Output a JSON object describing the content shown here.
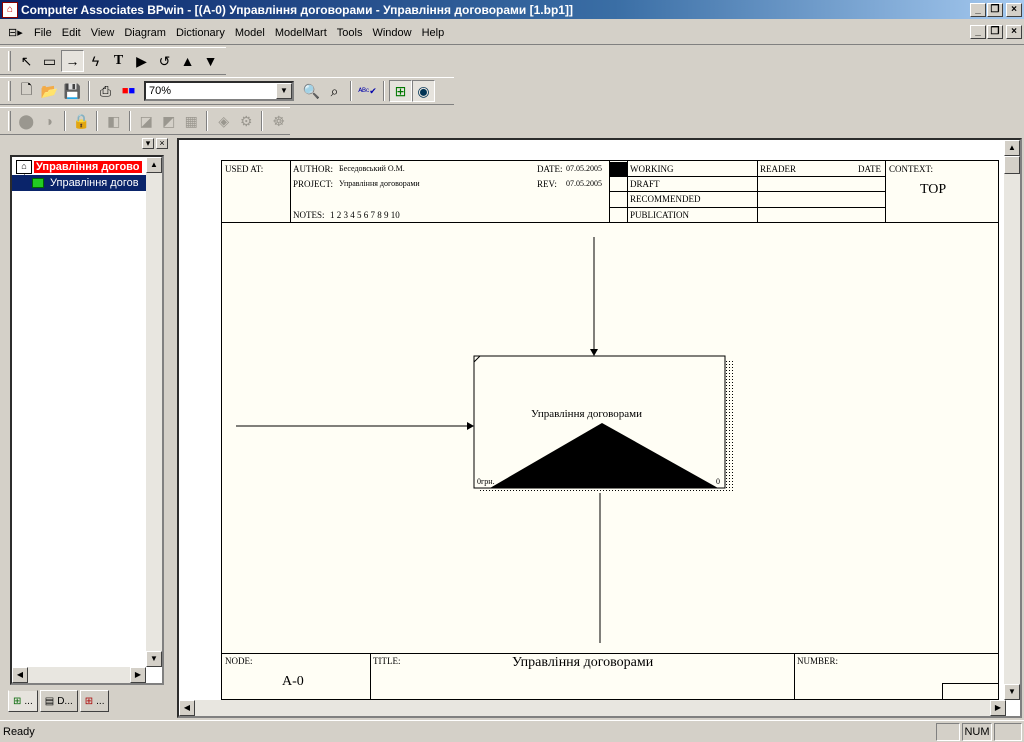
{
  "window": {
    "title": "Computer Associates BPwin - [(A-0) Управління договорами - Управління договорами  [1.bp1]]"
  },
  "menu": {
    "items": [
      "File",
      "Edit",
      "View",
      "Diagram",
      "Dictionary",
      "Model",
      "ModelMart",
      "Tools",
      "Window",
      "Help"
    ]
  },
  "toolbar": {
    "zoom": "70%"
  },
  "tree": {
    "root_label": "Управління догово",
    "child_label": "Управління догов"
  },
  "tabs": [
    "...",
    "D...",
    "..."
  ],
  "diagram": {
    "used_at_label": "USED AT:",
    "author_label": "AUTHOR:",
    "author": "Беседовський О.М.",
    "project_label": "PROJECT:",
    "project": "Управління договорами",
    "date_label": "DATE:",
    "date": "07.05.2005",
    "rev_label": "REV:",
    "rev": "07.05.2005",
    "notes_label": "NOTES:",
    "notes": "1  2  3  4  5  6  7  8  9  10",
    "status_working": "WORKING",
    "status_draft": "DRAFT",
    "status_recommended": "RECOMMENDED",
    "status_publication": "PUBLICATION",
    "reader_label": "READER",
    "reader_date_label": "DATE",
    "context_label": "CONTEXT:",
    "context_value": "TOP",
    "activity_name": "Управління договорами",
    "activity_cost": "0грн.",
    "activity_number": "0",
    "node_label": "NODE:",
    "node_value": "A-0",
    "title_label": "TITLE:",
    "title_value": "Управління договорами",
    "number_label": "NUMBER:"
  },
  "status": {
    "text": "Ready",
    "num": "NUM"
  }
}
